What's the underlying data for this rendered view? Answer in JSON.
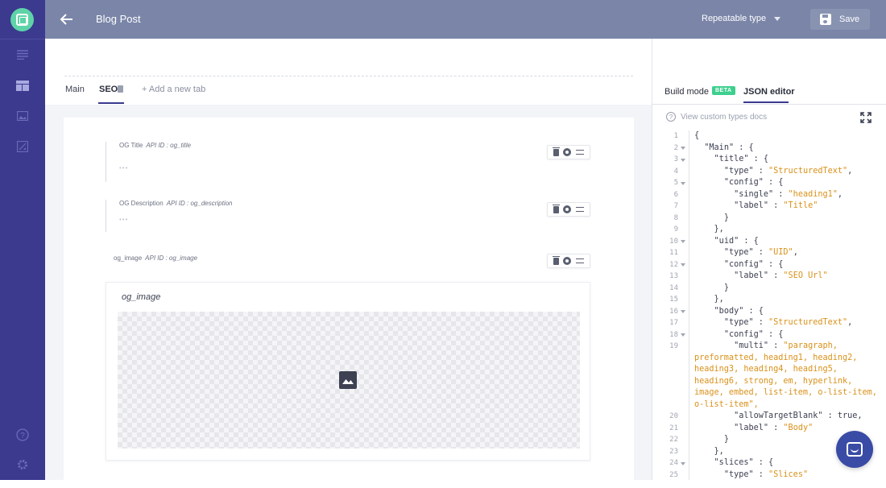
{
  "topbar": {
    "title": "Blog Post",
    "type_select": "Repeatable type",
    "save_label": "Save"
  },
  "tabs": {
    "main": "Main",
    "seo": "SEO",
    "add": "+ Add a new tab"
  },
  "fields": [
    {
      "label": "OG Title",
      "api": "API ID : og_title"
    },
    {
      "label": "OG Description",
      "api": "API ID : og_description"
    },
    {
      "label": "og_image",
      "api": "API ID : og_image"
    }
  ],
  "image_field": {
    "title": "og_image"
  },
  "rpanel": {
    "build_mode": "Build mode",
    "beta": "BETA",
    "json_editor": "JSON editor",
    "docs_link": "View custom types docs"
  },
  "code": {
    "l1": "{",
    "l2_k": "\"Main\" : {",
    "l3_k": "\"title\" : {",
    "l4_k": "\"type\" : ",
    "l4_v": "\"StructuredText\"",
    "l4_e": ",",
    "l5_k": "\"config\" : {",
    "l6_k": "\"single\" : ",
    "l6_v": "\"heading1\"",
    "l6_e": ",",
    "l7_k": "\"label\" : ",
    "l7_v": "\"Title\"",
    "l8": "}",
    "l9": "},",
    "l10_k": "\"uid\" : {",
    "l11_k": "\"type\" : ",
    "l11_v": "\"UID\"",
    "l11_e": ",",
    "l12_k": "\"config\" : {",
    "l13_k": "\"label\" : ",
    "l13_v": "\"SEO Url\"",
    "l14": "}",
    "l15": "},",
    "l16_k": "\"body\" : {",
    "l17_k": "\"type\" : ",
    "l17_v": "\"StructuredText\"",
    "l17_e": ",",
    "l18_k": "\"config\" : {",
    "l19_k": "\"multi\" : ",
    "l19_v1": "\"paragraph,",
    "l19_wrap": "preformatted, heading1, heading2, heading3, heading4, heading5, heading6, strong, em, hyperlink, image, embed, list-item, o-list-item, o-list-item\",",
    "l20_k": "\"allowTargetBlank\" : true,",
    "l21_k": "\"label\" : ",
    "l21_v": "\"Body\"",
    "l22": "}",
    "l23": "},",
    "l24_k": "\"slices\" : {",
    "l25_k": "\"type\" : ",
    "l25_v": "\"Slices\""
  },
  "line_numbers": [
    "1",
    "2",
    "3",
    "4",
    "5",
    "6",
    "7",
    "8",
    "9",
    "10",
    "11",
    "12",
    "13",
    "14",
    "15",
    "16",
    "17",
    "18",
    "19",
    "20",
    "21",
    "22",
    "23",
    "24",
    "25"
  ]
}
